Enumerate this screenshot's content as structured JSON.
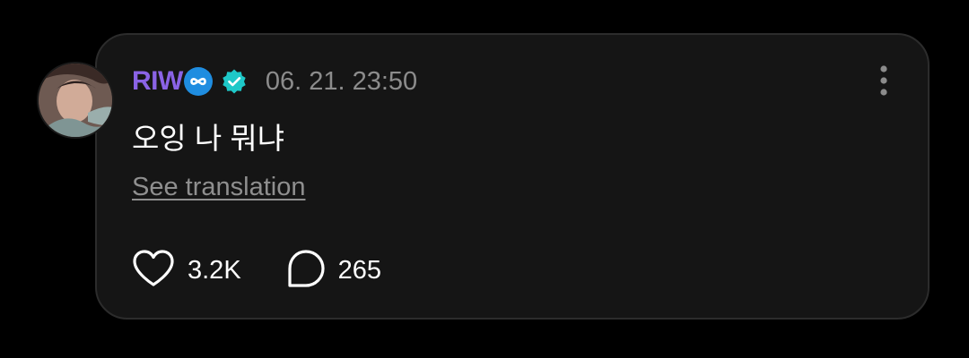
{
  "post": {
    "author": {
      "name": "RIW",
      "name_color": "#8a63e6",
      "badges": [
        "infinity-icon",
        "verified-icon"
      ]
    },
    "timestamp": "06. 21. 23:50",
    "message": "오잉 나 뭐냐",
    "translate_label": "See translation",
    "likes": "3.2K",
    "comments": "265"
  },
  "icons": {
    "more": "more-vertical-icon",
    "like": "heart-icon",
    "comment": "comment-icon"
  },
  "colors": {
    "background": "#000000",
    "card": "#151515",
    "accent": "#8a63e6",
    "verified": "#1ec8c8",
    "infinity": "#1f8de0"
  }
}
